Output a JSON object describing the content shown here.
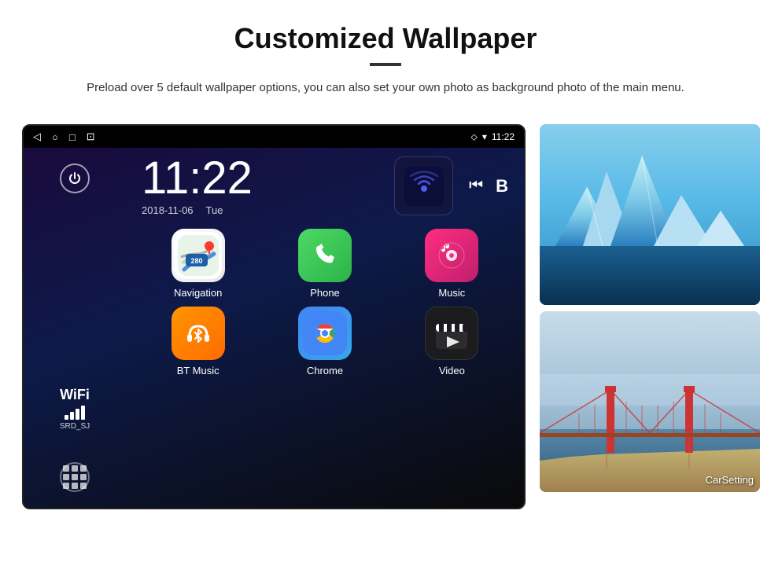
{
  "header": {
    "title": "Customized Wallpaper",
    "description": "Preload over 5 default wallpaper options, you can also set your own photo as background photo of the main menu."
  },
  "device": {
    "statusBar": {
      "time": "11:22",
      "icons": [
        "◁",
        "○",
        "□",
        "⊠"
      ]
    },
    "clock": {
      "time": "11:22",
      "date": "2018-11-06",
      "day": "Tue"
    },
    "wifi": {
      "label": "WiFi",
      "ssid": "SRD_SJ"
    },
    "apps": [
      {
        "name": "Navigation",
        "icon": "nav"
      },
      {
        "name": "Phone",
        "icon": "phone"
      },
      {
        "name": "Music",
        "icon": "music"
      },
      {
        "name": "BT Music",
        "icon": "bt"
      },
      {
        "name": "Chrome",
        "icon": "chrome"
      },
      {
        "name": "Video",
        "icon": "video"
      }
    ],
    "rightPanel": {
      "bottomApp": "CarSetting"
    }
  }
}
